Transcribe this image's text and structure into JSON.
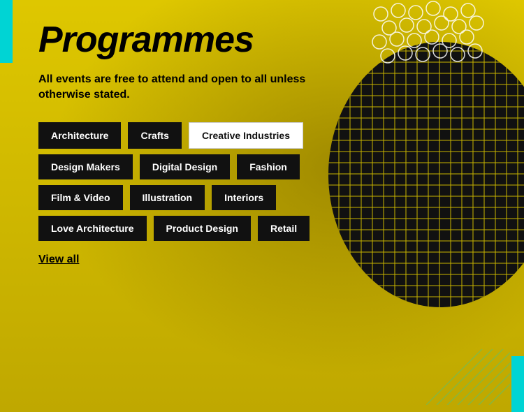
{
  "page": {
    "title": "Programmes",
    "subtitle": "All events are free to attend and open to all unless otherwise stated.",
    "view_all_label": "View all",
    "colors": {
      "yellow": "#e8d800",
      "black": "#111111",
      "white": "#ffffff",
      "cyan": "#00d4d4"
    }
  },
  "tags": {
    "row1": [
      {
        "label": "Architecture",
        "style": "dark"
      },
      {
        "label": "Crafts",
        "style": "dark"
      },
      {
        "label": "Creative Industries",
        "style": "light"
      }
    ],
    "row2": [
      {
        "label": "Design Makers",
        "style": "dark"
      },
      {
        "label": "Digital Design",
        "style": "dark"
      },
      {
        "label": "Fashion",
        "style": "dark"
      }
    ],
    "row3": [
      {
        "label": "Film & Video",
        "style": "dark"
      },
      {
        "label": "Illustration",
        "style": "dark"
      },
      {
        "label": "Interiors",
        "style": "dark"
      }
    ],
    "row4": [
      {
        "label": "Love Architecture",
        "style": "dark"
      },
      {
        "label": "Product Design",
        "style": "dark"
      },
      {
        "label": "Retail",
        "style": "dark"
      }
    ]
  }
}
